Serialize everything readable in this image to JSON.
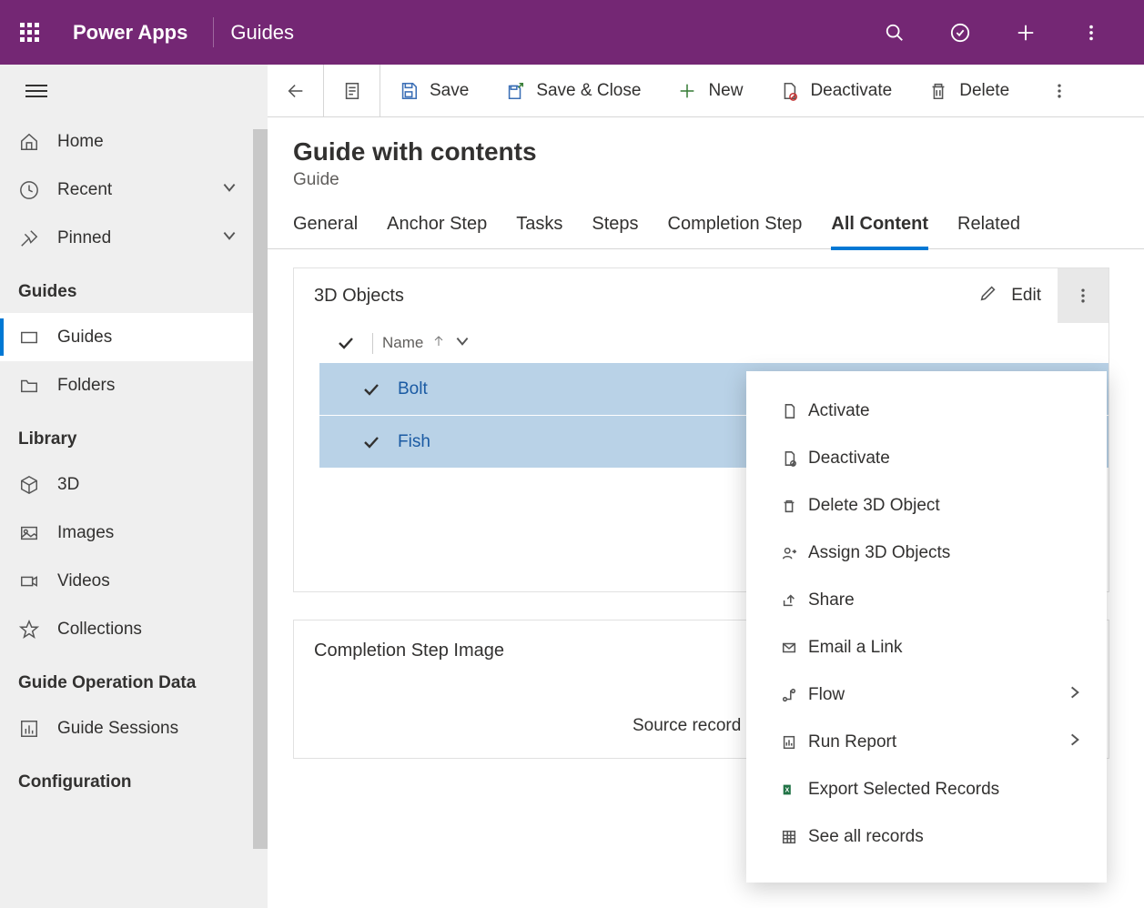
{
  "top": {
    "app_title": "Power Apps",
    "module": "Guides"
  },
  "sidebar": {
    "home": "Home",
    "recent": "Recent",
    "pinned": "Pinned",
    "section_guides": "Guides",
    "guides": "Guides",
    "folders": "Folders",
    "section_library": "Library",
    "three_d": "3D",
    "images": "Images",
    "videos": "Videos",
    "collections": "Collections",
    "section_guide_op": "Guide Operation Data",
    "guide_sessions": "Guide Sessions",
    "section_config": "Configuration"
  },
  "cmd": {
    "save": "Save",
    "save_close": "Save & Close",
    "new": "New",
    "deactivate": "Deactivate",
    "delete": "Delete"
  },
  "page": {
    "title": "Guide with contents",
    "subtitle": "Guide"
  },
  "tabs": {
    "general": "General",
    "anchor": "Anchor Step",
    "tasks": "Tasks",
    "steps": "Steps",
    "completion": "Completion Step",
    "all_content": "All Content",
    "related": "Related"
  },
  "panel1": {
    "title": "3D Objects",
    "edit": "Edit",
    "col_name": "Name",
    "rows": [
      "Bolt",
      "Fish"
    ]
  },
  "panel2": {
    "title": "Completion Step Image",
    "placeholder": "Source record not"
  },
  "menu": {
    "activate": "Activate",
    "deactivate": "Deactivate",
    "delete": "Delete 3D Object",
    "assign": "Assign 3D Objects",
    "share": "Share",
    "email": "Email a Link",
    "flow": "Flow",
    "run_report": "Run Report",
    "export": "Export Selected Records",
    "see_all": "See all records"
  }
}
